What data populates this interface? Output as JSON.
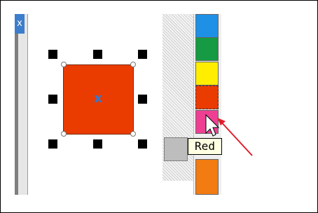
{
  "window": {
    "corner_glyph": "x"
  },
  "selection": {
    "shape_color": "#ea3b00",
    "center_marker": "x"
  },
  "palette": {
    "swatches": [
      {
        "name": "blue",
        "color": "#1e90e6"
      },
      {
        "name": "green",
        "color": "#169a43"
      },
      {
        "name": "yellow",
        "color": "#ffee00"
      },
      {
        "name": "red",
        "color": "#ea3b00"
      },
      {
        "name": "pink",
        "color": "#ef3f93"
      },
      {
        "name": "orange",
        "color": "#f27c12"
      }
    ],
    "tooltip": "Red"
  },
  "annotation": {
    "arrow_color": "#e21d2b"
  }
}
